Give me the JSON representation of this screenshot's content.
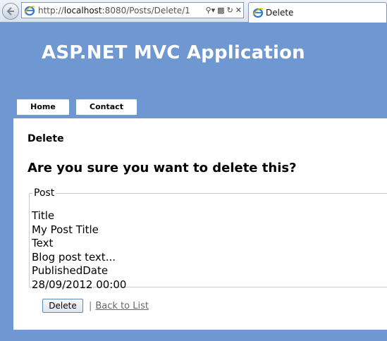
{
  "browser": {
    "url_prefix": "http://",
    "url_host": "localhost",
    "url_rest": ":8080/Posts/Delete/1",
    "tab_title": "Delete"
  },
  "header": {
    "title": "ASP.NET MVC Application"
  },
  "menu": {
    "items": [
      {
        "label": "Home"
      },
      {
        "label": "Contact"
      }
    ]
  },
  "main": {
    "heading": "Delete",
    "confirm_question": "Are you sure you want to delete this?",
    "fieldset_legend": "Post",
    "fields": [
      {
        "label": "Title",
        "value": "My Post Title"
      },
      {
        "label": "Text",
        "value": "Blog post text..."
      },
      {
        "label": "PublishedDate",
        "value": "28/09/2012 00:00"
      }
    ],
    "delete_button": "Delete",
    "separator": "|",
    "back_link": "Back to List"
  },
  "icons": {
    "back": "back-arrow-icon",
    "page": "ie-page-icon",
    "search": "search-icon",
    "compat": "compatibility-view-icon",
    "refresh": "refresh-icon",
    "stop": "stop-icon"
  }
}
